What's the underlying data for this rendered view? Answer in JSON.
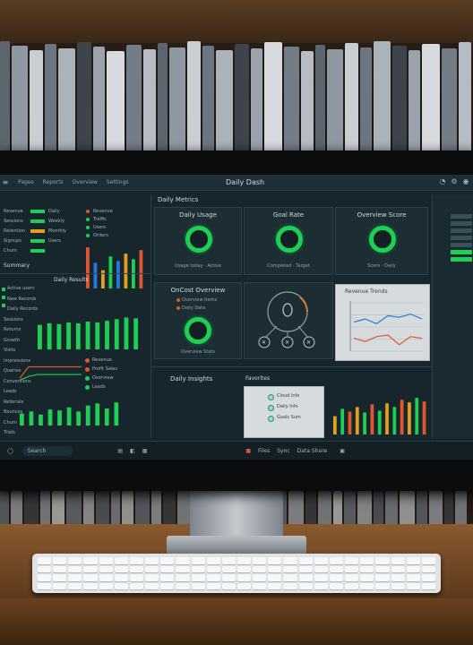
{
  "app": {
    "title": "Daily Dash",
    "menu": [
      "Pages",
      "Reports",
      "Overview",
      "Settings"
    ],
    "section_title": "Daily Metrics"
  },
  "left_panel": {
    "rows": [
      {
        "label": "Revenue",
        "value": "Daily",
        "accent": "#1ecf53"
      },
      {
        "label": "Sessions",
        "value": "Weekly",
        "accent": "#1ecf53"
      },
      {
        "label": "Retention",
        "value": "Monthly",
        "accent": "#e0a020"
      },
      {
        "label": "Signups",
        "value": "Users",
        "accent": "#1ecf53"
      },
      {
        "label": "Churn",
        "value": "",
        "accent": "#1ecf53"
      }
    ],
    "summary": "Summary",
    "legend_top": [
      {
        "label": "Revenue",
        "color": "#e0572e"
      },
      {
        "label": "Traffic",
        "color": "#1ecf53"
      },
      {
        "label": "Users",
        "color": "#1ecf53"
      },
      {
        "label": "Orders",
        "color": "#1ecf53"
      }
    ],
    "section2_title": "Daily Results",
    "list2": [
      "Active users",
      "New Records",
      "Daily Records",
      "Sessions",
      "Returns",
      "Growth",
      "Visits",
      "Impressions",
      "Queries",
      "Conversions",
      "Leads",
      "Referrals",
      "Bounces",
      "Churn",
      "Trials"
    ],
    "legend2": [
      {
        "label": "Revenue",
        "color": "#e0572e"
      },
      {
        "label": "Profit Sales",
        "color": "#e0572e"
      },
      {
        "label": "Overview",
        "color": "#1ecf53"
      },
      {
        "label": "Leads",
        "color": "#1ecf53"
      }
    ]
  },
  "cards": [
    {
      "title": "Daily Usage",
      "caption": "Usage today · Active"
    },
    {
      "title": "Goal Rate",
      "caption": "Completed · Target"
    },
    {
      "title": "Overview Score",
      "caption": "Score · Daily"
    }
  ],
  "mid_card": {
    "title": "OnCost Overview",
    "items": [
      "Overview Items",
      "Daily Data"
    ],
    "caption": "Overview Stats"
  },
  "line_chart_panel": {
    "title": "Revenue Trends"
  },
  "bottom": {
    "left_title": "Daily Insights",
    "list_title": "Favorites",
    "list": [
      "Cloud Info",
      "Daily Info",
      "Goals Sum"
    ]
  },
  "taskbar": {
    "search": "Search",
    "items": [
      "Files",
      "Sync",
      "Data Share"
    ]
  },
  "chart_data": [
    {
      "type": "bar",
      "values": [
        45,
        28,
        20,
        35,
        30,
        38,
        32,
        42
      ],
      "ylim": [
        0,
        50
      ]
    },
    {
      "type": "bar",
      "values": [
        30,
        32,
        31,
        33,
        32,
        34,
        33,
        35,
        37,
        39,
        38
      ],
      "ylim": [
        0,
        45
      ]
    },
    {
      "type": "line",
      "series": [
        {
          "color": "#e0572e",
          "values": [
            10,
            22,
            22,
            22,
            22,
            22,
            22,
            22
          ]
        },
        {
          "color": "#1ecf53",
          "values": [
            8,
            12,
            14,
            14,
            14,
            14,
            14,
            14
          ]
        }
      ],
      "ylim": [
        0,
        30
      ]
    },
    {
      "type": "bar",
      "values": [
        12,
        14,
        11,
        16,
        15,
        18,
        14,
        20,
        22,
        17,
        23
      ],
      "ylim": [
        0,
        25
      ]
    },
    {
      "type": "line",
      "series": [
        {
          "color": "#2a78d8",
          "values": [
            18,
            20,
            17,
            22,
            21,
            23,
            20
          ]
        },
        {
          "color": "#e0572e",
          "values": [
            8,
            6,
            9,
            10,
            4,
            9,
            8
          ]
        }
      ],
      "ylim": [
        0,
        30
      ]
    },
    {
      "type": "bar",
      "values": [
        20,
        28,
        25,
        30,
        24,
        33,
        26,
        34,
        30,
        38,
        35,
        40,
        36
      ],
      "ylim": [
        0,
        45
      ]
    }
  ]
}
